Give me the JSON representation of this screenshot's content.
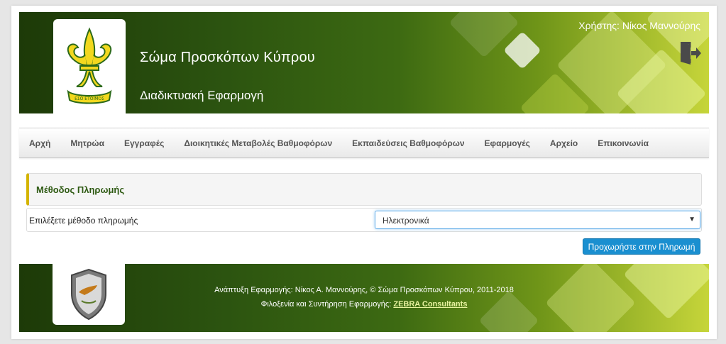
{
  "header": {
    "title": "Σώμα Προσκόπων Κύπρου",
    "subtitle": "Διαδικτυακή Εφαρμογή",
    "user_label": "Χρήστης: Νίκος Μαννούρης",
    "logo_motto": "ΕΣΟ ΕΤΟΙΜΟΣ",
    "logout_icon": "logout-icon"
  },
  "nav": {
    "items": [
      "Αρχή",
      "Μητρώα",
      "Εγγραφές",
      "Διοικητικές Μεταβολές Βαθμοφόρων",
      "Εκπαιδεύσεις Βαθμοφόρων",
      "Εφαρμογές",
      "Αρχείο",
      "Επικοινωνία"
    ]
  },
  "panel": {
    "heading": "Μέθοδος Πληρωμής",
    "label": "Επιλέξετε μέθοδο πληρωμής",
    "select_value": "Ηλεκτρονικά",
    "button": "Προχωρήστε στην Πληρωμή"
  },
  "footer": {
    "line1": "Ανάπτυξη Εφαρμογής: Νίκος Α. Μαννούρης, © Σώμα Προσκόπων Κύπρου, 2011-2018",
    "line2_prefix": "Φιλοξενία και Συντήρηση Εφαρμογής:",
    "link": "ZEBRA Consultants"
  },
  "colors": {
    "header_dark": "#1d3a08",
    "header_light": "#c6d53a",
    "accent_yellow": "#d4b400",
    "heading_green": "#2e5a13",
    "button_blue": "#1a8fd0"
  }
}
